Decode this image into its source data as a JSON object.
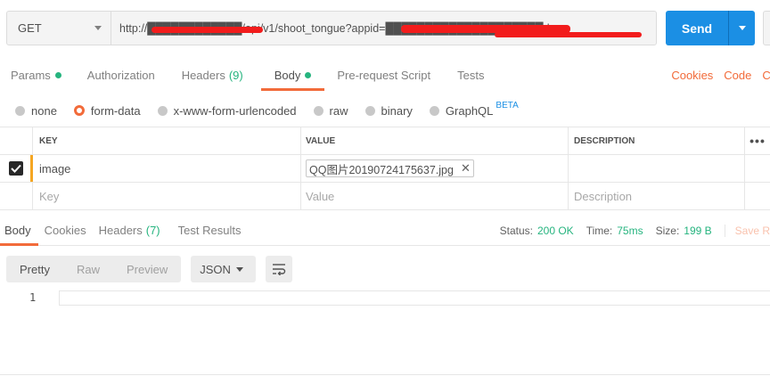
{
  "request": {
    "method": "GET",
    "url": "http://████████████/api/v1/shoot_tongue?appid=████████████████████d.",
    "send_label": "Send"
  },
  "request_tabs": [
    {
      "label": "Params",
      "dot": true
    },
    {
      "label": "Authorization"
    },
    {
      "label": "Headers",
      "count": "(9)"
    },
    {
      "label": "Body",
      "dot": true,
      "active": true
    },
    {
      "label": "Pre-request Script"
    },
    {
      "label": "Tests"
    }
  ],
  "request_links": {
    "cookies": "Cookies",
    "code": "Code",
    "comments_cut": "Co"
  },
  "body_types": [
    {
      "label": "none"
    },
    {
      "label": "form-data",
      "selected": true
    },
    {
      "label": "x-www-form-urlencoded"
    },
    {
      "label": "raw"
    },
    {
      "label": "binary"
    },
    {
      "label": "GraphQL",
      "badge": "BETA"
    }
  ],
  "form_table": {
    "headers": {
      "key": "KEY",
      "value": "VALUE",
      "description": "DESCRIPTION",
      "more": "•••"
    },
    "rows": [
      {
        "checked": true,
        "key": "image",
        "value_file": "QQ图片20190724175637.jpg",
        "description": ""
      }
    ],
    "placeholder": {
      "key": "Key",
      "value": "Value",
      "description": "Description"
    }
  },
  "response_tabs": [
    {
      "label": "Body",
      "active": true
    },
    {
      "label": "Cookies"
    },
    {
      "label": "Headers",
      "count": "(7)"
    },
    {
      "label": "Test Results"
    }
  ],
  "response_status": {
    "status_label": "Status:",
    "status_value": "200 OK",
    "time_label": "Time:",
    "time_value": "75ms",
    "size_label": "Size:",
    "size_value": "199 B",
    "save_label": "Save R"
  },
  "view_modes": [
    "Pretty",
    "Raw",
    "Preview"
  ],
  "format": "JSON",
  "editor": {
    "line_number": "1"
  },
  "colors": {
    "accent": "#f26b3a",
    "send": "#1b8fe4",
    "green": "#26b47f",
    "redaction": "#f21c1c"
  }
}
